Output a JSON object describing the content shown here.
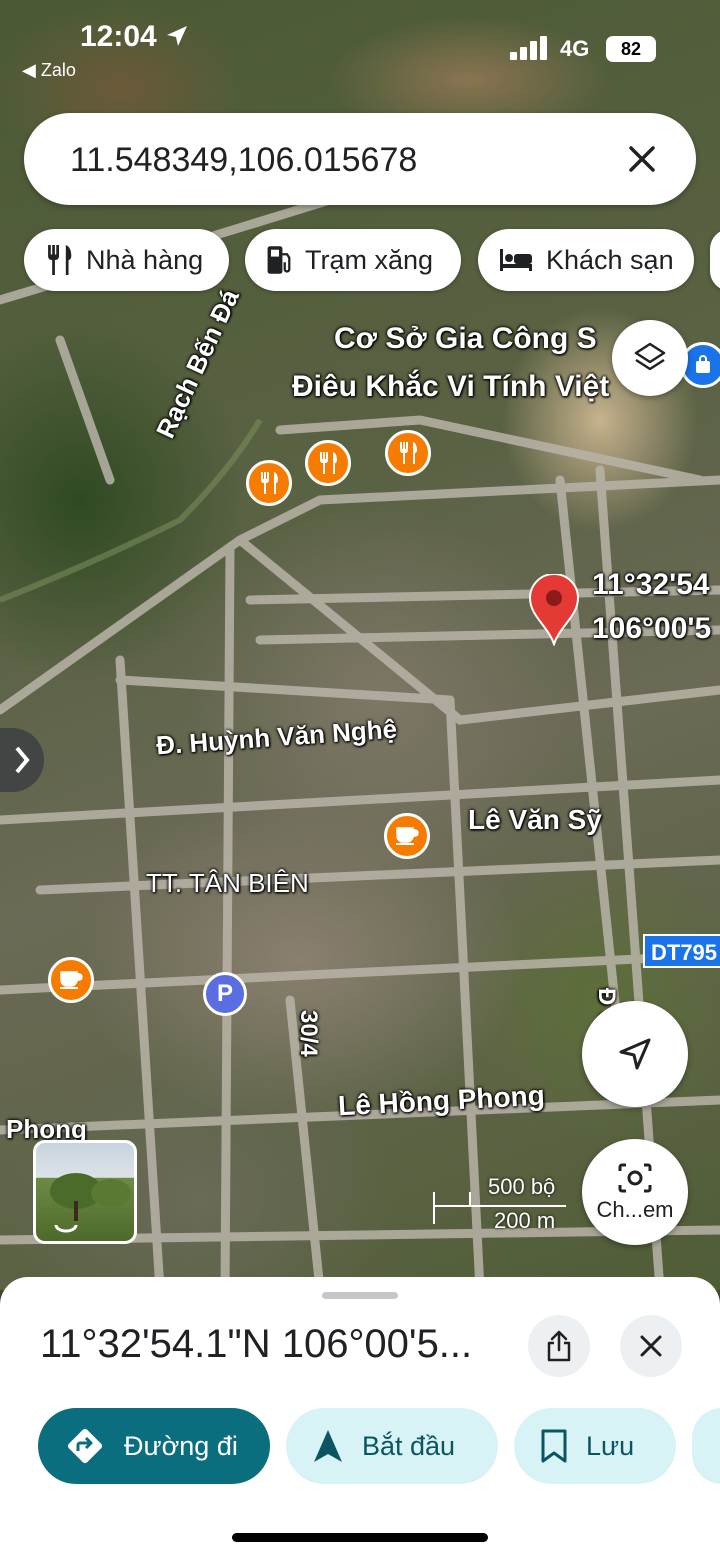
{
  "status_bar": {
    "time": "12:04",
    "back_app": "◀ Zalo",
    "network": "4G",
    "battery": "82"
  },
  "search": {
    "value": "11.548349,106.015678"
  },
  "chips": [
    {
      "label": "Nhà hàng",
      "icon": "restaurant-icon"
    },
    {
      "label": "Trạm xăng",
      "icon": "gas-station-icon"
    },
    {
      "label": "Khách sạn",
      "icon": "hotel-icon"
    }
  ],
  "map": {
    "labels": {
      "poi_line1": "Cơ Sở Gia Công S",
      "poi_line2": "Điêu Khắc Vi Tính Việt",
      "river": "Rạch Bến Đá",
      "street_huynh": "Đ. Huỳnh Văn Nghệ",
      "street_le_van_sy": "Lê Văn Sỹ",
      "town": "TT. TÂN BIÊN",
      "street_30_4": "30/4",
      "street_le_hong_phong": "Lê Hồng Phong",
      "street_phong": "Phong",
      "street_right": "Đ Số 2",
      "pin_lat": "11°32'54",
      "pin_lon": "106°00'5"
    },
    "road_shield": "DT795",
    "parking": "P",
    "scale": {
      "imperial": "500 bộ",
      "metric": "200 m"
    },
    "lens_label": "Ch...em"
  },
  "sheet": {
    "title": "11°32'54.1\"N 106°00'5...",
    "actions": {
      "directions": "Đường đi",
      "start": "Bắt đầu",
      "save": "Lưu"
    }
  }
}
